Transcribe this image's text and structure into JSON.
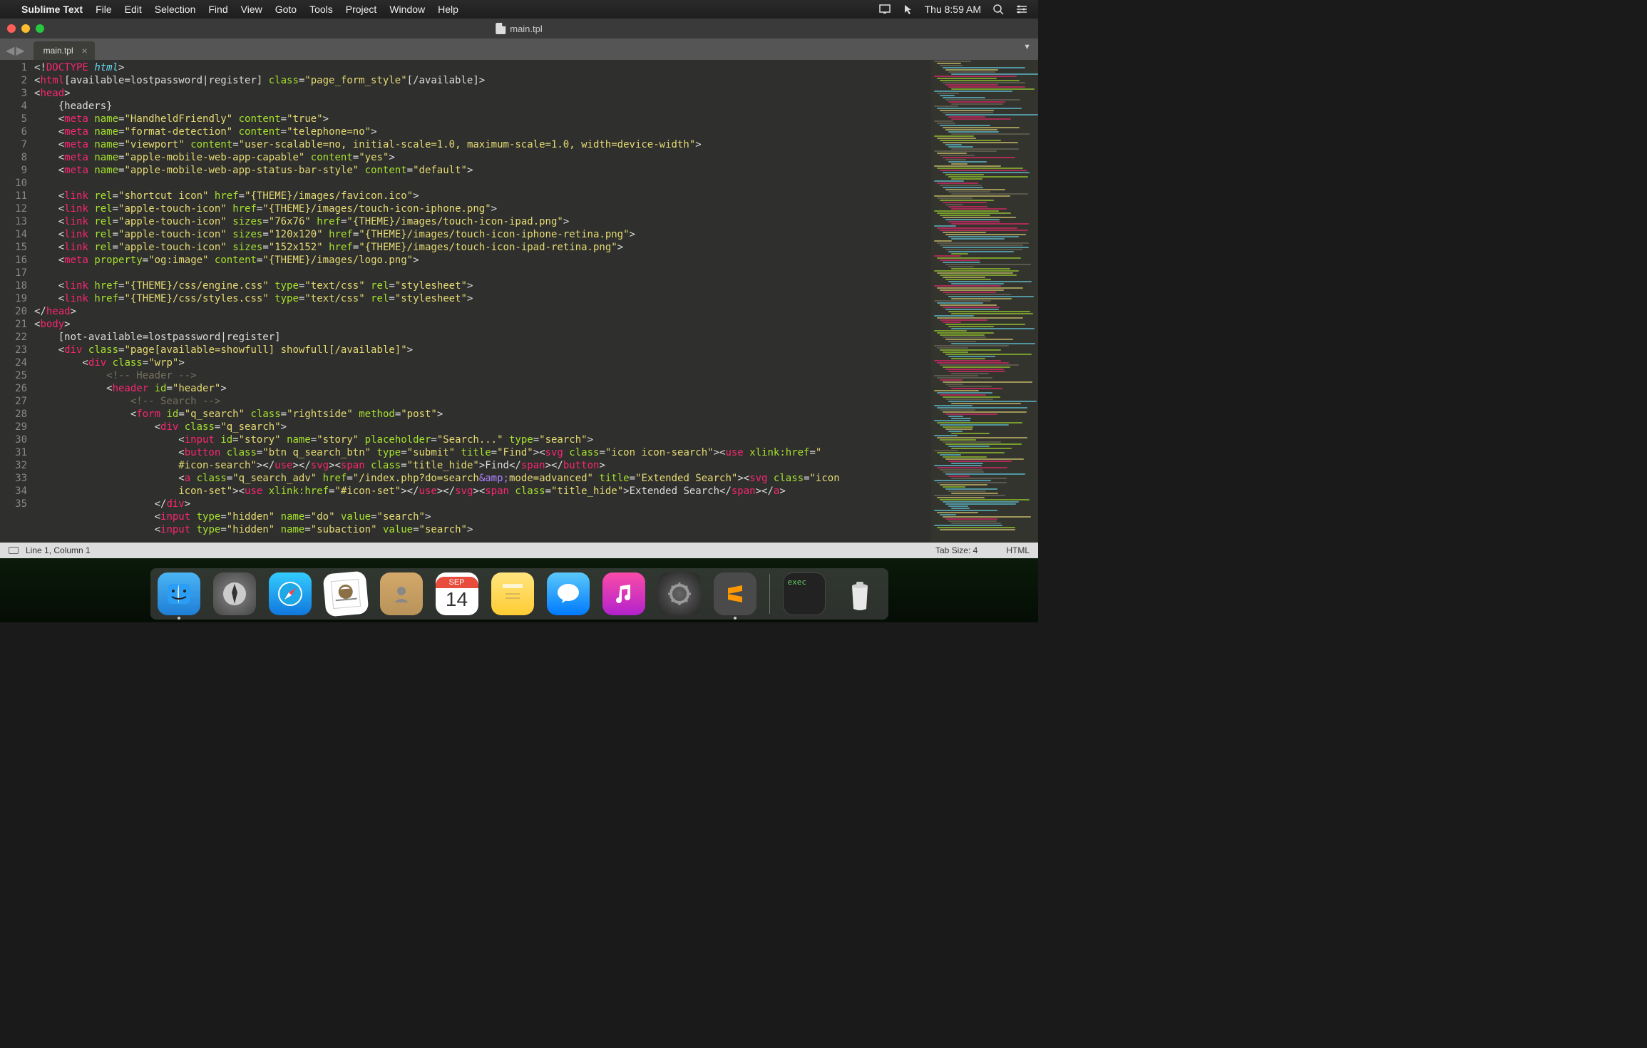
{
  "menubar": {
    "app_name": "Sublime Text",
    "items": [
      "File",
      "Edit",
      "Selection",
      "Find",
      "View",
      "Goto",
      "Tools",
      "Project",
      "Window",
      "Help"
    ],
    "clock": "Thu 8:59 AM"
  },
  "window": {
    "title": "main.tpl"
  },
  "tab": {
    "label": "main.tpl"
  },
  "statusbar": {
    "position": "Line 1, Column 1",
    "tab_size": "Tab Size: 4",
    "syntax": "HTML"
  },
  "code_lines": [
    {
      "n": 1,
      "h": "<span class='p'>&lt;!</span><span class='t'>DOCTYPE</span><span class='p'> </span><span class='d'>html</span><span class='p'>&gt;</span>"
    },
    {
      "n": 2,
      "h": "<span class='p'>&lt;</span><span class='t'>html</span><span class='p'>[available=lostpassword|register] </span><span class='a'>class</span><span class='p'>=</span><span class='s'>\"page_form_style\"</span><span class='p'>[/available]&gt;</span>"
    },
    {
      "n": 3,
      "h": "<span class='p'>&lt;</span><span class='t'>head</span><span class='p'>&gt;</span>"
    },
    {
      "n": 4,
      "h": "<span class='p'>    {headers}</span>"
    },
    {
      "n": 5,
      "h": "<span class='p'>    &lt;</span><span class='t'>meta</span><span class='p'> </span><span class='a'>name</span><span class='p'>=</span><span class='s'>\"HandheldFriendly\"</span><span class='p'> </span><span class='a'>content</span><span class='p'>=</span><span class='s'>\"true\"</span><span class='p'>&gt;</span>"
    },
    {
      "n": 6,
      "h": "<span class='p'>    &lt;</span><span class='t'>meta</span><span class='p'> </span><span class='a'>name</span><span class='p'>=</span><span class='s'>\"format-detection\"</span><span class='p'> </span><span class='a'>content</span><span class='p'>=</span><span class='s'>\"telephone=no\"</span><span class='p'>&gt;</span>"
    },
    {
      "n": 7,
      "h": "<span class='p'>    &lt;</span><span class='t'>meta</span><span class='p'> </span><span class='a'>name</span><span class='p'>=</span><span class='s'>\"viewport\"</span><span class='p'> </span><span class='a'>content</span><span class='p'>=</span><span class='s'>\"user-scalable=no, initial-scale=1.0, maximum-scale=1.0, width=device-width\"</span><span class='p'>&gt;</span>"
    },
    {
      "n": 8,
      "h": "<span class='p'>    &lt;</span><span class='t'>meta</span><span class='p'> </span><span class='a'>name</span><span class='p'>=</span><span class='s'>\"apple-mobile-web-app-capable\"</span><span class='p'> </span><span class='a'>content</span><span class='p'>=</span><span class='s'>\"yes\"</span><span class='p'>&gt;</span>"
    },
    {
      "n": 9,
      "h": "<span class='p'>    &lt;</span><span class='t'>meta</span><span class='p'> </span><span class='a'>name</span><span class='p'>=</span><span class='s'>\"apple-mobile-web-app-status-bar-style\"</span><span class='p'> </span><span class='a'>content</span><span class='p'>=</span><span class='s'>\"default\"</span><span class='p'>&gt;</span>"
    },
    {
      "n": 10,
      "h": ""
    },
    {
      "n": 11,
      "h": "<span class='p'>    &lt;</span><span class='t'>link</span><span class='p'> </span><span class='a'>rel</span><span class='p'>=</span><span class='s'>\"shortcut icon\"</span><span class='p'> </span><span class='a'>href</span><span class='p'>=</span><span class='s'>\"{THEME}/images/favicon.ico\"</span><span class='p'>&gt;</span>"
    },
    {
      "n": 12,
      "h": "<span class='p'>    &lt;</span><span class='t'>link</span><span class='p'> </span><span class='a'>rel</span><span class='p'>=</span><span class='s'>\"apple-touch-icon\"</span><span class='p'> </span><span class='a'>href</span><span class='p'>=</span><span class='s'>\"{THEME}/images/touch-icon-iphone.png\"</span><span class='p'>&gt;</span>"
    },
    {
      "n": 13,
      "h": "<span class='p'>    &lt;</span><span class='t'>link</span><span class='p'> </span><span class='a'>rel</span><span class='p'>=</span><span class='s'>\"apple-touch-icon\"</span><span class='p'> </span><span class='a'>sizes</span><span class='p'>=</span><span class='s'>\"76x76\"</span><span class='p'> </span><span class='a'>href</span><span class='p'>=</span><span class='s'>\"{THEME}/images/touch-icon-ipad.png\"</span><span class='p'>&gt;</span>"
    },
    {
      "n": 14,
      "h": "<span class='p'>    &lt;</span><span class='t'>link</span><span class='p'> </span><span class='a'>rel</span><span class='p'>=</span><span class='s'>\"apple-touch-icon\"</span><span class='p'> </span><span class='a'>sizes</span><span class='p'>=</span><span class='s'>\"120x120\"</span><span class='p'> </span><span class='a'>href</span><span class='p'>=</span><span class='s'>\"{THEME}/images/touch-icon-iphone-retina.png\"</span><span class='p'>&gt;</span>"
    },
    {
      "n": 15,
      "h": "<span class='p'>    &lt;</span><span class='t'>link</span><span class='p'> </span><span class='a'>rel</span><span class='p'>=</span><span class='s'>\"apple-touch-icon\"</span><span class='p'> </span><span class='a'>sizes</span><span class='p'>=</span><span class='s'>\"152x152\"</span><span class='p'> </span><span class='a'>href</span><span class='p'>=</span><span class='s'>\"{THEME}/images/touch-icon-ipad-retina.png\"</span><span class='p'>&gt;</span>"
    },
    {
      "n": 16,
      "h": "<span class='p'>    &lt;</span><span class='t'>meta</span><span class='p'> </span><span class='a'>property</span><span class='p'>=</span><span class='s'>\"og:image\"</span><span class='p'> </span><span class='a'>content</span><span class='p'>=</span><span class='s'>\"{THEME}/images/logo.png\"</span><span class='p'>&gt;</span>"
    },
    {
      "n": 17,
      "h": ""
    },
    {
      "n": 18,
      "h": "<span class='p'>    &lt;</span><span class='t'>link</span><span class='p'> </span><span class='a'>href</span><span class='p'>=</span><span class='s'>\"{THEME}/css/engine.css\"</span><span class='p'> </span><span class='a'>type</span><span class='p'>=</span><span class='s'>\"text/css\"</span><span class='p'> </span><span class='a'>rel</span><span class='p'>=</span><span class='s'>\"stylesheet\"</span><span class='p'>&gt;</span>"
    },
    {
      "n": 19,
      "h": "<span class='p'>    &lt;</span><span class='t'>link</span><span class='p'> </span><span class='a'>href</span><span class='p'>=</span><span class='s'>\"{THEME}/css/styles.css\"</span><span class='p'> </span><span class='a'>type</span><span class='p'>=</span><span class='s'>\"text/css\"</span><span class='p'> </span><span class='a'>rel</span><span class='p'>=</span><span class='s'>\"stylesheet\"</span><span class='p'>&gt;</span>"
    },
    {
      "n": 20,
      "h": "<span class='p'>&lt;/</span><span class='t'>head</span><span class='p'>&gt;</span>"
    },
    {
      "n": 21,
      "h": "<span class='p'>&lt;</span><span class='t'>body</span><span class='p'>&gt;</span>"
    },
    {
      "n": 22,
      "h": "<span class='p'>    [not-available=lostpassword|register]</span>"
    },
    {
      "n": 23,
      "h": "<span class='p'>    &lt;</span><span class='t'>div</span><span class='p'> </span><span class='a'>class</span><span class='p'>=</span><span class='s'>\"page[available=showfull] showfull[/available]\"</span><span class='p'>&gt;</span>"
    },
    {
      "n": 24,
      "h": "<span class='p'>        &lt;</span><span class='t'>div</span><span class='p'> </span><span class='a'>class</span><span class='p'>=</span><span class='s'>\"wrp\"</span><span class='p'>&gt;</span>"
    },
    {
      "n": 25,
      "h": "<span class='p'>            </span><span class='c'>&lt;!-- Header --&gt;</span>"
    },
    {
      "n": 26,
      "h": "<span class='p'>            &lt;</span><span class='t'>header</span><span class='p'> </span><span class='a'>id</span><span class='p'>=</span><span class='s'>\"header\"</span><span class='p'>&gt;</span>"
    },
    {
      "n": 27,
      "h": "<span class='p'>                </span><span class='c'>&lt;!-- Search --&gt;</span>"
    },
    {
      "n": 28,
      "h": "<span class='p'>                &lt;</span><span class='t'>form</span><span class='p'> </span><span class='a'>id</span><span class='p'>=</span><span class='s'>\"q_search\"</span><span class='p'> </span><span class='a'>class</span><span class='p'>=</span><span class='s'>\"rightside\"</span><span class='p'> </span><span class='a'>method</span><span class='p'>=</span><span class='s'>\"post\"</span><span class='p'>&gt;</span>"
    },
    {
      "n": 29,
      "h": "<span class='p'>                    &lt;</span><span class='t'>div</span><span class='p'> </span><span class='a'>class</span><span class='p'>=</span><span class='s'>\"q_search\"</span><span class='p'>&gt;</span>"
    },
    {
      "n": 30,
      "h": "<span class='p'>                        &lt;</span><span class='t'>input</span><span class='p'> </span><span class='a'>id</span><span class='p'>=</span><span class='s'>\"story\"</span><span class='p'> </span><span class='a'>name</span><span class='p'>=</span><span class='s'>\"story\"</span><span class='p'> </span><span class='a'>placeholder</span><span class='p'>=</span><span class='s'>\"Search...\"</span><span class='p'> </span><span class='a'>type</span><span class='p'>=</span><span class='s'>\"search\"</span><span class='p'>&gt;</span>"
    },
    {
      "n": 31,
      "h": "<span class='p'>                        &lt;</span><span class='t'>button</span><span class='p'> </span><span class='a'>class</span><span class='p'>=</span><span class='s'>\"btn q_search_btn\"</span><span class='p'> </span><span class='a'>type</span><span class='p'>=</span><span class='s'>\"submit\"</span><span class='p'> </span><span class='a'>title</span><span class='p'>=</span><span class='s'>\"Find\"</span><span class='p'>&gt;&lt;</span><span class='t'>svg</span><span class='p'> </span><span class='a'>class</span><span class='p'>=</span><span class='s'>\"icon icon-search\"</span><span class='p'>&gt;&lt;</span><span class='t'>use</span><span class='p'> </span><span class='a'>xlink:href</span><span class='p'>=</span><span class='s'>\"</span>"
    },
    {
      "n": "",
      "h": "<span class='s'>                        #icon-search\"</span><span class='p'>&gt;&lt;/</span><span class='t'>use</span><span class='p'>&gt;&lt;/</span><span class='t'>svg</span><span class='p'>&gt;&lt;</span><span class='t'>span</span><span class='p'> </span><span class='a'>class</span><span class='p'>=</span><span class='s'>\"title_hide\"</span><span class='p'>&gt;Find&lt;/</span><span class='t'>span</span><span class='p'>&gt;&lt;/</span><span class='t'>button</span><span class='p'>&gt;</span>"
    },
    {
      "n": 32,
      "h": "<span class='p'>                        &lt;</span><span class='t'>a</span><span class='p'> </span><span class='a'>class</span><span class='p'>=</span><span class='s'>\"q_search_adv\"</span><span class='p'> </span><span class='a'>href</span><span class='p'>=</span><span class='s'>\"/index.php?do=search</span><span class='amp'>&amp;amp;</span><span class='s'>mode=advanced\"</span><span class='p'> </span><span class='a'>title</span><span class='p'>=</span><span class='s'>\"Extended Search\"</span><span class='p'>&gt;&lt;</span><span class='t'>svg</span><span class='p'> </span><span class='a'>class</span><span class='p'>=</span><span class='s'>\"icon </span>"
    },
    {
      "n": "",
      "h": "<span class='s'>                        icon-set\"</span><span class='p'>&gt;&lt;</span><span class='t'>use</span><span class='p'> </span><span class='a'>xlink:href</span><span class='p'>=</span><span class='s'>\"#icon-set\"</span><span class='p'>&gt;&lt;/</span><span class='t'>use</span><span class='p'>&gt;&lt;/</span><span class='t'>svg</span><span class='p'>&gt;&lt;</span><span class='t'>span</span><span class='p'> </span><span class='a'>class</span><span class='p'>=</span><span class='s'>\"title_hide\"</span><span class='p'>&gt;Extended Search&lt;/</span><span class='t'>span</span><span class='p'>&gt;&lt;/</span><span class='t'>a</span><span class='p'>&gt;</span>"
    },
    {
      "n": 33,
      "h": "<span class='p'>                    &lt;/</span><span class='t'>div</span><span class='p'>&gt;</span>"
    },
    {
      "n": 34,
      "h": "<span class='p'>                    &lt;</span><span class='t'>input</span><span class='p'> </span><span class='a'>type</span><span class='p'>=</span><span class='s'>\"hidden\"</span><span class='p'> </span><span class='a'>name</span><span class='p'>=</span><span class='s'>\"do\"</span><span class='p'> </span><span class='a'>value</span><span class='p'>=</span><span class='s'>\"search\"</span><span class='p'>&gt;</span>"
    },
    {
      "n": 35,
      "h": "<span class='p'>                    &lt;</span><span class='t'>input</span><span class='p'> </span><span class='a'>type</span><span class='p'>=</span><span class='s'>\"hidden\"</span><span class='p'> </span><span class='a'>name</span><span class='p'>=</span><span class='s'>\"subaction\"</span><span class='p'> </span><span class='a'>value</span><span class='p'>=</span><span class='s'>\"search\"</span><span class='p'>&gt;</span>"
    }
  ],
  "dock": {
    "items": [
      "finder",
      "launchpad",
      "safari",
      "mail",
      "contacts",
      "calendar",
      "notes",
      "messages",
      "music",
      "settings",
      "sublime"
    ],
    "calendar_month": "SEP",
    "calendar_day": "14",
    "exec_label": "exec"
  }
}
